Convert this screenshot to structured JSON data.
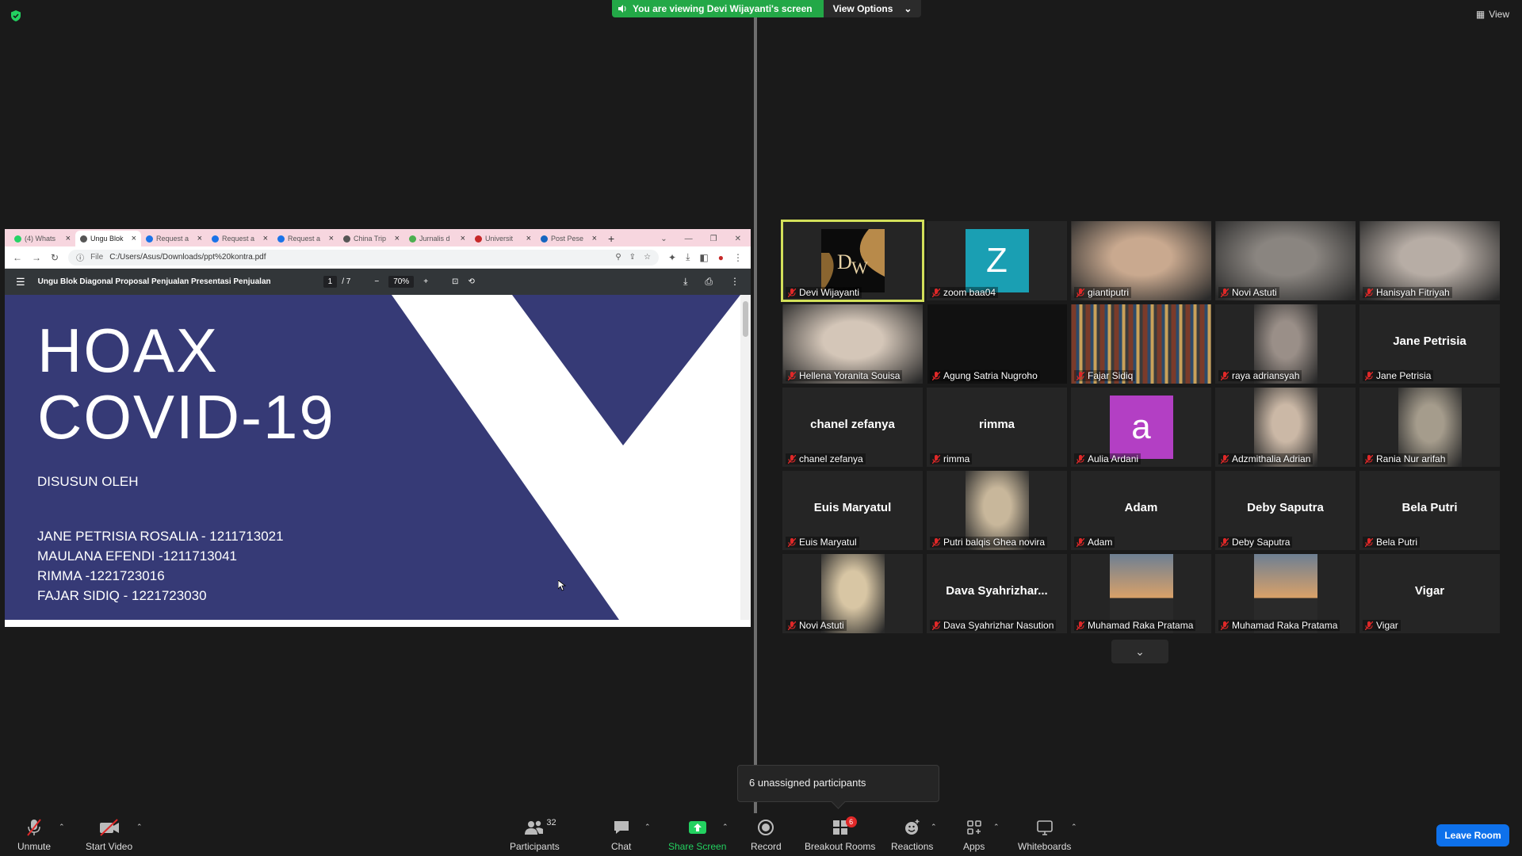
{
  "top": {
    "viewing_banner": "You are viewing Devi Wijayanti's screen",
    "view_options": "View Options",
    "view_label": "View"
  },
  "browser": {
    "tabs": [
      {
        "label": "(4) Whats",
        "color": "#25d366"
      },
      {
        "label": "Ungu Blok",
        "color": "#555555",
        "active": true
      },
      {
        "label": "Request a",
        "color": "#1a73e8"
      },
      {
        "label": "Request a",
        "color": "#1a73e8"
      },
      {
        "label": "Request a",
        "color": "#1a73e8"
      },
      {
        "label": "China Trip",
        "color": "#555555"
      },
      {
        "label": "Jurnalis d",
        "color": "#4caf50"
      },
      {
        "label": "Universit",
        "color": "#c62828"
      },
      {
        "label": "Post Pese",
        "color": "#1565c0"
      }
    ],
    "address_prefix": "File",
    "address": "C:/Users/Asus/Downloads/ppt%20kontra.pdf",
    "pdf_title": "Ungu Blok Diagonal Proposal Penjualan Presentasi Penjualan",
    "page_current": "1",
    "page_total": "/ 7",
    "zoom": "70%"
  },
  "slide": {
    "title_line1": "HOAX",
    "title_line2": "COVID-19",
    "by": "DISUSUN OLEH",
    "names": [
      "JANE PETRISIA ROSALIA - 1211713021",
      "MAULANA EFENDI -1211713041",
      "RIMMA -1221723016",
      "FAJAR SIDIQ - 1221723030"
    ],
    "bg_color": "#363a76"
  },
  "participants": [
    {
      "name": "Devi Wijayanti",
      "kind": "logo",
      "active": true
    },
    {
      "name": "zoom baa04",
      "kind": "avatar",
      "letter": "Z",
      "color": "#1a9fb3"
    },
    {
      "name": "giantiputri",
      "kind": "photo",
      "tone": "#c9a98f"
    },
    {
      "name": "Novi Astuti",
      "kind": "photo",
      "tone": "#8a8580"
    },
    {
      "name": "Hanisyah Fitriyah",
      "kind": "photo",
      "tone": "#b7ada5"
    },
    {
      "name": "Hellena Yoranita Souisa",
      "kind": "photo",
      "tone": "#d4c6b8"
    },
    {
      "name": "Agung Satria Nugroho",
      "kind": "photo",
      "tone": "#121212"
    },
    {
      "name": "Fajar Sidiq",
      "kind": "photo",
      "tone": "#6b4a3a"
    },
    {
      "name": "raya adriansyah",
      "kind": "photo",
      "tone": "#9a8f88"
    },
    {
      "name": "Jane Petrisia",
      "kind": "text",
      "display": "Jane Petrisia"
    },
    {
      "name": "chanel zefanya",
      "kind": "text",
      "display": "chanel zefanya"
    },
    {
      "name": "rimma",
      "kind": "text",
      "display": "rimma"
    },
    {
      "name": "Aulia Ardani",
      "kind": "avatar",
      "letter": "a",
      "color": "#b33fc4"
    },
    {
      "name": "Adzmithalia Adrian",
      "kind": "photo",
      "tone": "#cbb8a6"
    },
    {
      "name": "Rania Nur arifah",
      "kind": "photo",
      "tone": "#a59c8c"
    },
    {
      "name": "Euis Maryatul",
      "kind": "text",
      "display": "Euis Maryatul"
    },
    {
      "name": "Putri balqis Ghea novira",
      "kind": "photo",
      "tone": "#c8b79b"
    },
    {
      "name": "Adam",
      "kind": "text",
      "display": "Adam"
    },
    {
      "name": "Deby Saputra",
      "kind": "text",
      "display": "Deby Saputra"
    },
    {
      "name": "Bela Putri",
      "kind": "text",
      "display": "Bela Putri"
    },
    {
      "name": "Novi Astuti",
      "kind": "photo",
      "tone": "#d8c6a4"
    },
    {
      "name": "Dava Syahrizhar Nasution",
      "kind": "text",
      "display": "Dava  Syahrizhar..."
    },
    {
      "name": "Muhamad Raka Pratama",
      "kind": "photo",
      "tone": "#4f5b6b"
    },
    {
      "name": "Muhamad Raka Pratama",
      "kind": "photo",
      "tone": "#4f5b6b"
    },
    {
      "name": "Vigar",
      "kind": "text",
      "display": "Vigar"
    }
  ],
  "unassigned": "6 unassigned participants",
  "toolbar": {
    "unmute": "Unmute",
    "start_video": "Start Video",
    "participants": "Participants",
    "participants_count": "32",
    "chat": "Chat",
    "share_screen": "Share Screen",
    "record": "Record",
    "breakout_rooms": "Breakout Rooms",
    "breakout_badge": "6",
    "reactions": "Reactions",
    "apps": "Apps",
    "whiteboards": "Whiteboards",
    "leave_room": "Leave Room"
  },
  "colors": {
    "banner_green": "#23a847",
    "active_outline": "#d3e05a",
    "leave_blue": "#0e71eb",
    "muted_red": "#e02828"
  }
}
